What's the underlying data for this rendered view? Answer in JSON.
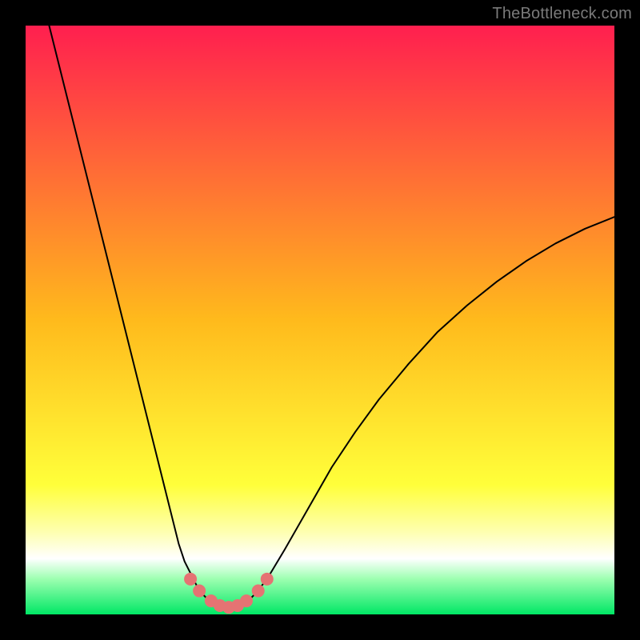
{
  "watermark": "TheBottleneck.com",
  "chart_data": {
    "type": "line",
    "title": "",
    "xlabel": "",
    "ylabel": "",
    "xlim": [
      0,
      100
    ],
    "ylim": [
      0,
      100
    ],
    "grid": false,
    "legend": false,
    "gradient_stops": [
      {
        "offset": 0,
        "color": "#ff1f4f"
      },
      {
        "offset": 0.5,
        "color": "#ffba1c"
      },
      {
        "offset": 0.78,
        "color": "#ffff3a"
      },
      {
        "offset": 0.86,
        "color": "#feffb0"
      },
      {
        "offset": 0.905,
        "color": "#ffffff"
      },
      {
        "offset": 0.94,
        "color": "#9cffb0"
      },
      {
        "offset": 1.0,
        "color": "#00e765"
      }
    ],
    "series": [
      {
        "name": "curve-left",
        "stroke": "#000000",
        "stroke_width": 2,
        "x": [
          4,
          6,
          8,
          10,
          12,
          14,
          16,
          18,
          20,
          22,
          24,
          26,
          27,
          28,
          29,
          30,
          31
        ],
        "y": [
          100,
          92,
          84,
          76,
          68,
          60,
          52,
          44,
          36,
          28,
          20,
          12,
          9,
          7,
          5,
          3.5,
          2.5
        ]
      },
      {
        "name": "valley-floor",
        "stroke": "#000000",
        "stroke_width": 2,
        "x": [
          31,
          32,
          33,
          34,
          35,
          36,
          37,
          38,
          39
        ],
        "y": [
          2.5,
          1.7,
          1.3,
          1.1,
          1.1,
          1.3,
          1.7,
          2.5,
          3.5
        ]
      },
      {
        "name": "curve-right",
        "stroke": "#000000",
        "stroke_width": 2,
        "x": [
          39,
          41,
          44,
          48,
          52,
          56,
          60,
          65,
          70,
          75,
          80,
          85,
          90,
          95,
          100
        ],
        "y": [
          3.5,
          6,
          11,
          18,
          25,
          31,
          36.5,
          42.5,
          48,
          52.5,
          56.5,
          60,
          63,
          65.5,
          67.5
        ]
      },
      {
        "name": "markers",
        "type": "scatter",
        "marker_color": "#e57373",
        "marker_radius": 8,
        "x": [
          28,
          29.5,
          31.5,
          33,
          34.5,
          36,
          37.5,
          39.5,
          41
        ],
        "y": [
          6,
          4,
          2.3,
          1.5,
          1.2,
          1.5,
          2.3,
          4,
          6
        ]
      }
    ]
  }
}
